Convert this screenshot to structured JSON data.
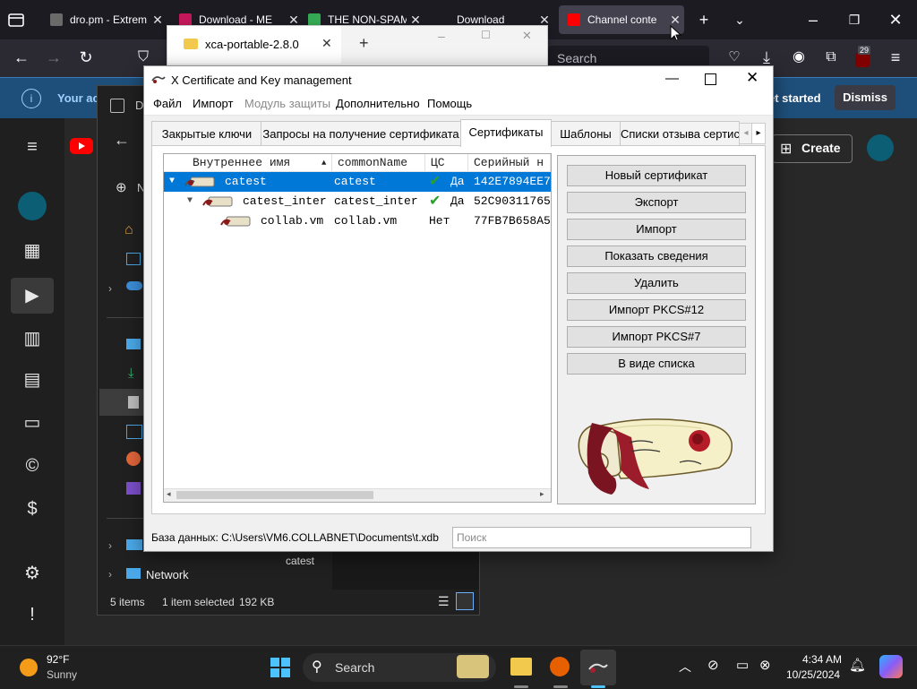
{
  "browser": {
    "tabs": [
      {
        "title": "dro.pm - Extrem",
        "favicon_color": "#6a6a6a"
      },
      {
        "title": "Download - ME",
        "favicon_color": "#c2185b"
      },
      {
        "title": "THE NON-SPAM",
        "favicon_color": "#34a853"
      },
      {
        "title": "Download",
        "favicon_color": "#1c1b22"
      },
      {
        "title": "Channel conte",
        "favicon_color": "#ff0000"
      }
    ],
    "search_placeholder": "Search",
    "extensions_badge": "29",
    "notice": {
      "text": "Your ac",
      "get_started": "et started",
      "dismiss": "Dismiss"
    }
  },
  "youtube": {
    "create_label": "Create",
    "accent": "#ff0000"
  },
  "explorer": {
    "tab_title": "D",
    "new_label": "N",
    "network_label": "Network",
    "status_items": "5 items",
    "status_selected": "1 item selected",
    "status_size": "192 KB",
    "selected_file": "catest"
  },
  "ghost_window": {
    "title": "xca-portable-2.8.0",
    "close": "✕",
    "new_tab": "+"
  },
  "xca": {
    "title": "X Certificate and Key management",
    "menu": [
      "Файл",
      "Импорт",
      "Модуль защиты",
      "Дополнительно",
      "Помощь"
    ],
    "tabs": [
      "Закрытые ключи",
      "Запросы на получение сертификата",
      "Сертификаты",
      "Шаблоны",
      "Списки отзыва сертис"
    ],
    "active_tab": "Сертификаты",
    "columns": [
      "Внутреннее имя",
      "commonName",
      "ЦС",
      "Серийный н"
    ],
    "rows": [
      {
        "name": "catest",
        "cn": "catest",
        "ca": "Да",
        "serial": "142E7894EE7",
        "selected": true
      },
      {
        "name": "catest_inter",
        "cn": "catest_inter",
        "ca": "Да",
        "serial": "52C90311765",
        "selected": false
      },
      {
        "name": "collab.vm",
        "cn": "collab.vm",
        "ca": "Нет",
        "serial": "77FB7B658A5",
        "selected": false
      }
    ],
    "buttons": {
      "new_cert": "Новый сертификат",
      "export": "Экспорт",
      "import": "Импорт",
      "show_details": "Показать сведения",
      "delete": "Удалить",
      "import_pkcs12": "Импорт PKCS#12",
      "import_pkcs7": "Импорт PKCS#7",
      "as_list": "В виде списка"
    },
    "database_label": "База данных: C:\\Users\\VM6.COLLABNET\\Documents\\t.xdb",
    "search_placeholder": "Поиск",
    "selection_color": "#0078d7"
  },
  "taskbar": {
    "weather_temp": "92°F",
    "weather_desc": "Sunny",
    "search_label": "Search",
    "time": "4:34 AM",
    "date": "10/25/2024"
  }
}
